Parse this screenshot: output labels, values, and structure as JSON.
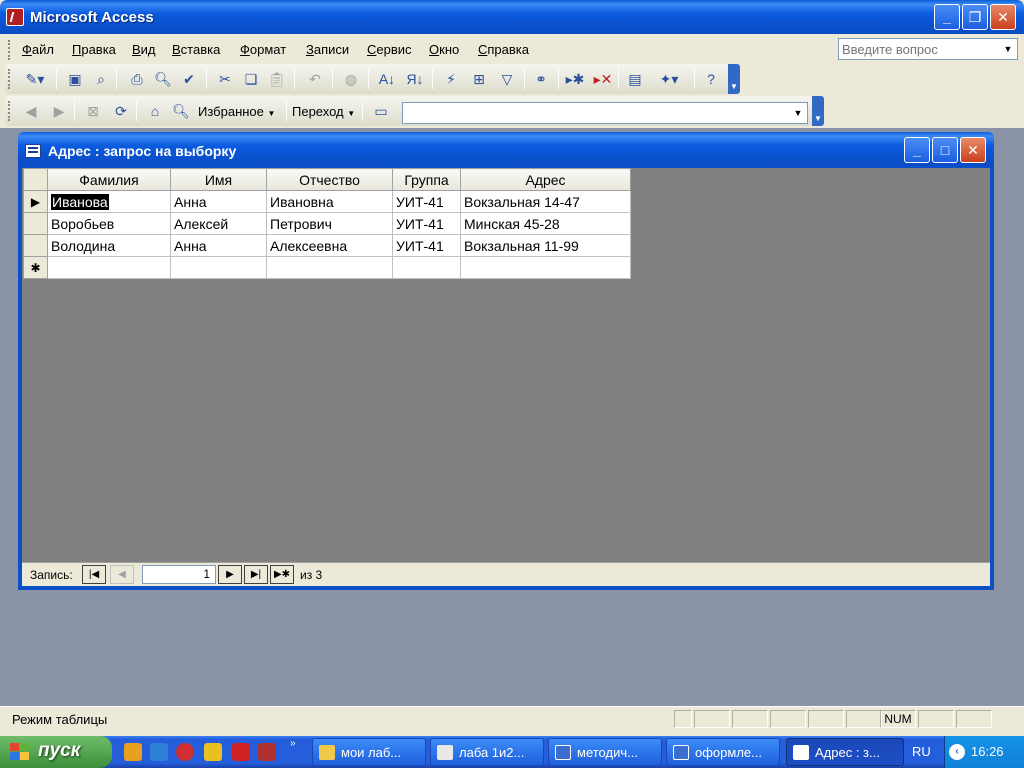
{
  "app": {
    "title": "Microsoft Access"
  },
  "menu": {
    "items": [
      "Файл",
      "Правка",
      "Вид",
      "Вставка",
      "Формат",
      "Записи",
      "Сервис",
      "Окно",
      "Справка"
    ],
    "ask_placeholder": "Введите вопрос"
  },
  "web_toolbar": {
    "favorites": "Избранное",
    "go": "Переход"
  },
  "child": {
    "title": "Адрес : запрос на выборку",
    "columns": [
      "Фамилия",
      "Имя",
      "Отчество",
      "Группа",
      "Адрес"
    ],
    "rows": [
      [
        "Иванова",
        "Анна",
        "Ивановна",
        "УИТ-41",
        "Вокзальная 14-47"
      ],
      [
        "Воробьев",
        "Алексей",
        "Петрович",
        "УИТ-41",
        "Минская 45-28"
      ],
      [
        "Володина",
        "Анна",
        "Алексеевна",
        "УИТ-41",
        "Вокзальная 11-99"
      ]
    ],
    "nav": {
      "label": "Запись:",
      "current": "1",
      "of": "из  3"
    }
  },
  "status": {
    "text": "Режим таблицы",
    "num": "NUM"
  },
  "taskbar": {
    "start": "пуск",
    "tasks": [
      "мои лаб...",
      "лаба 1и2...",
      "методич...",
      "оформле...",
      "Адрес : з..."
    ],
    "lang": "RU",
    "clock": "16:26"
  }
}
